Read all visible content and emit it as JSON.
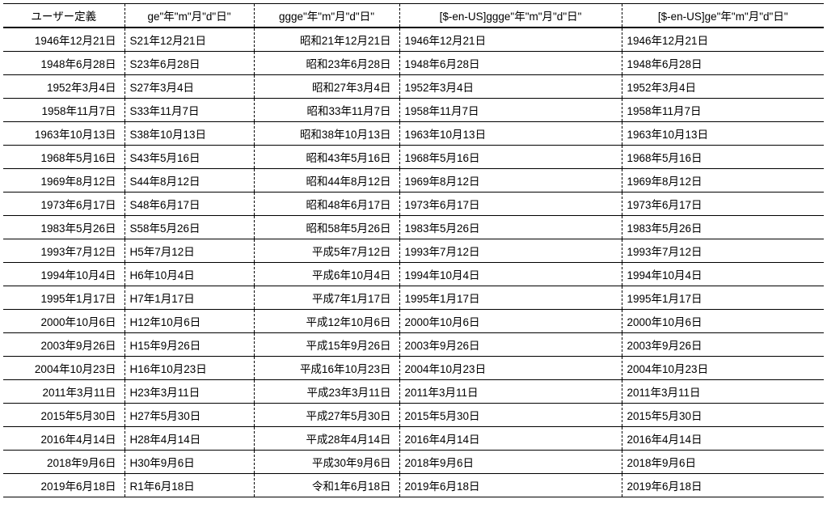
{
  "headers": [
    "ユーザー定義",
    "ge\"年\"m\"月\"d\"日\"",
    "ggge\"年\"m\"月\"d\"日\"",
    "[$-en-US]ggge\"年\"m\"月\"d\"日\"",
    "[$-en-US]ge\"年\"m\"月\"d\"日\""
  ],
  "rows": [
    [
      "1946年12月21日",
      "S21年12月21日",
      "昭和21年12月21日",
      "1946年12月21日",
      "1946年12月21日"
    ],
    [
      "1948年6月28日",
      "S23年6月28日",
      "昭和23年6月28日",
      "1948年6月28日",
      "1948年6月28日"
    ],
    [
      "1952年3月4日",
      "S27年3月4日",
      "昭和27年3月4日",
      "1952年3月4日",
      "1952年3月4日"
    ],
    [
      "1958年11月7日",
      "S33年11月7日",
      "昭和33年11月7日",
      "1958年11月7日",
      "1958年11月7日"
    ],
    [
      "1963年10月13日",
      "S38年10月13日",
      "昭和38年10月13日",
      "1963年10月13日",
      "1963年10月13日"
    ],
    [
      "1968年5月16日",
      "S43年5月16日",
      "昭和43年5月16日",
      "1968年5月16日",
      "1968年5月16日"
    ],
    [
      "1969年8月12日",
      "S44年8月12日",
      "昭和44年8月12日",
      "1969年8月12日",
      "1969年8月12日"
    ],
    [
      "1973年6月17日",
      "S48年6月17日",
      "昭和48年6月17日",
      "1973年6月17日",
      "1973年6月17日"
    ],
    [
      "1983年5月26日",
      "S58年5月26日",
      "昭和58年5月26日",
      "1983年5月26日",
      "1983年5月26日"
    ],
    [
      "1993年7月12日",
      "H5年7月12日",
      "平成5年7月12日",
      "1993年7月12日",
      "1993年7月12日"
    ],
    [
      "1994年10月4日",
      "H6年10月4日",
      "平成6年10月4日",
      "1994年10月4日",
      "1994年10月4日"
    ],
    [
      "1995年1月17日",
      "H7年1月17日",
      "平成7年1月17日",
      "1995年1月17日",
      "1995年1月17日"
    ],
    [
      "2000年10月6日",
      "H12年10月6日",
      "平成12年10月6日",
      "2000年10月6日",
      "2000年10月6日"
    ],
    [
      "2003年9月26日",
      "H15年9月26日",
      "平成15年9月26日",
      "2003年9月26日",
      "2003年9月26日"
    ],
    [
      "2004年10月23日",
      "H16年10月23日",
      "平成16年10月23日",
      "2004年10月23日",
      "2004年10月23日"
    ],
    [
      "2011年3月11日",
      "H23年3月11日",
      "平成23年3月11日",
      "2011年3月11日",
      "2011年3月11日"
    ],
    [
      "2015年5月30日",
      "H27年5月30日",
      "平成27年5月30日",
      "2015年5月30日",
      "2015年5月30日"
    ],
    [
      "2016年4月14日",
      "H28年4月14日",
      "平成28年4月14日",
      "2016年4月14日",
      "2016年4月14日"
    ],
    [
      "2018年9月6日",
      "H30年9月6日",
      "平成30年9月6日",
      "2018年9月6日",
      "2018年9月6日"
    ],
    [
      "2019年6月18日",
      "R1年6月18日",
      "令和1年6月18日",
      "2019年6月18日",
      "2019年6月18日"
    ]
  ]
}
